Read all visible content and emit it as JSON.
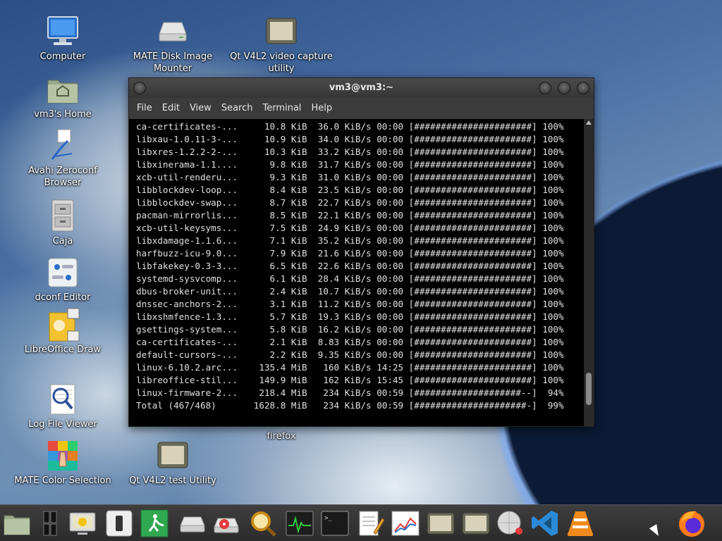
{
  "desktop": {
    "icons": [
      {
        "label": "Computer"
      },
      {
        "label": "vm3's Home"
      },
      {
        "label": "Avahi Zeroconf Browser"
      },
      {
        "label": "Caja"
      },
      {
        "label": "dconf Editor"
      },
      {
        "label": "LibreOffice Draw"
      },
      {
        "label": "Log File Viewer"
      },
      {
        "label": "MATE Color Selection"
      },
      {
        "label": "MATE Disk Image Mounter"
      },
      {
        "label": "Qt V4L2 video capture utility"
      },
      {
        "label": "Qt V4L2 test Utility"
      },
      {
        "label": "firefox"
      }
    ]
  },
  "terminal": {
    "title": "vm3@vm3:~",
    "menu": [
      "File",
      "Edit",
      "View",
      "Search",
      "Terminal",
      "Help"
    ],
    "lines": [
      "ca-certificates-...     10.8 KiB  36.0 KiB/s 00:00 [######################] 100%",
      "libxau-1.0.11-3-...     10.9 KiB  34.0 KiB/s 00:00 [######################] 100%",
      "libxres-1.2.2-2-...     10.3 KiB  33.2 KiB/s 00:00 [######################] 100%",
      "libxinerama-1.1....      9.8 KiB  31.7 KiB/s 00:00 [######################] 100%",
      "xcb-util-renderu...      9.3 KiB  31.0 KiB/s 00:00 [######################] 100%",
      "libblockdev-loop...      8.4 KiB  23.5 KiB/s 00:00 [######################] 100%",
      "libblockdev-swap...      8.7 KiB  22.7 KiB/s 00:00 [######################] 100%",
      "pacman-mirrorlis...      8.5 KiB  22.1 KiB/s 00:00 [######################] 100%",
      "xcb-util-keysyms...      7.5 KiB  24.9 KiB/s 00:00 [######################] 100%",
      "libxdamage-1.1.6...      7.1 KiB  35.2 KiB/s 00:00 [######################] 100%",
      "harfbuzz-icu-9.0...      7.9 KiB  21.6 KiB/s 00:00 [######################] 100%",
      "libfakekey-0.3-3...      6.5 KiB  22.6 KiB/s 00:00 [######################] 100%",
      "systemd-sysvcomp...      6.1 KiB  28.4 KiB/s 00:00 [######################] 100%",
      "dbus-broker-unit...      2.4 KiB  10.7 KiB/s 00:00 [######################] 100%",
      "dnssec-anchors-2...      3.1 KiB  11.2 KiB/s 00:00 [######################] 100%",
      "libxshmfence-1.3...      5.7 KiB  19.3 KiB/s 00:00 [######################] 100%",
      "gsettings-system...      5.8 KiB  16.2 KiB/s 00:00 [######################] 100%",
      "ca-certificates-...      2.1 KiB  8.83 KiB/s 00:00 [######################] 100%",
      "default-cursors-...      2.2 KiB  9.35 KiB/s 00:00 [######################] 100%",
      "linux-6.10.2.arc...    135.4 MiB   160 KiB/s 14:25 [######################] 100%",
      "libreoffice-stil...    149.9 MiB   162 KiB/s 15:45 [######################] 100%",
      "linux-firmware-2...    218.4 MiB   234 KiB/s 00:59 [####################--]  94%",
      "Total (467/468)       1628.8 MiB   234 KiB/s 00:59 [#####################-]  99%"
    ],
    "scroll_position": 0.95
  },
  "taskbar": {
    "items": [
      "folder-icon",
      "workspace-switcher-icon",
      "monitor-icon",
      "mobile-device-icon",
      "exit-icon",
      "disk-drive-icon",
      "disk-image-icon",
      "magnifier-icon",
      "system-monitor-icon",
      "terminal-icon",
      "text-editor-icon",
      "chart-icon",
      "camera-icon",
      "camera-test-icon",
      "globe-icon",
      "vscode-icon",
      "vlc-icon",
      "firefox-icon"
    ]
  }
}
